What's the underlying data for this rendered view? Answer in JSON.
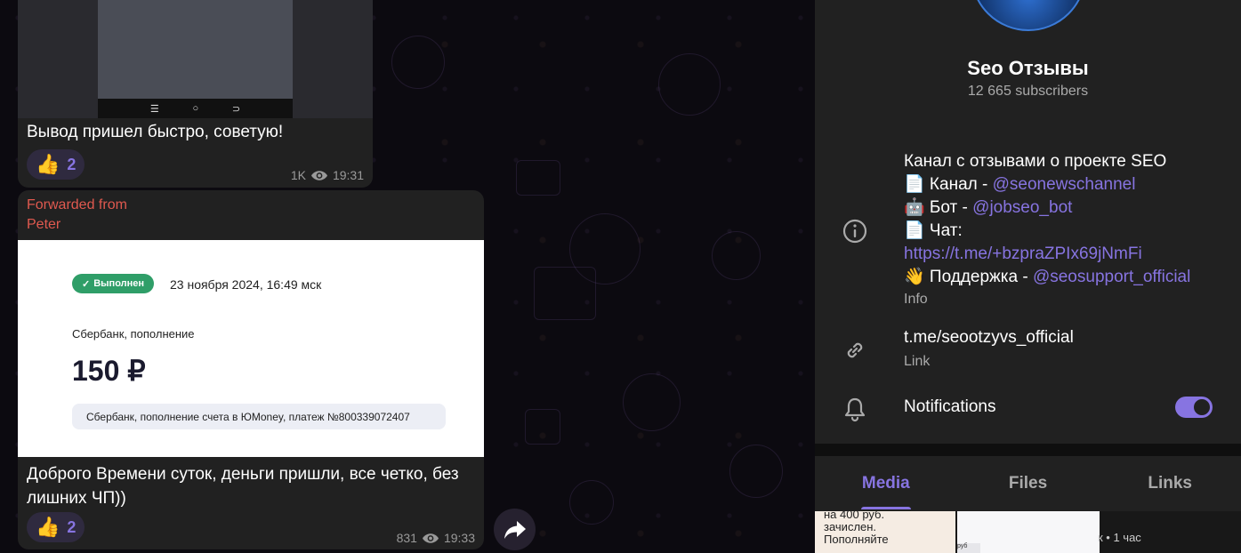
{
  "chat": {
    "msg1": {
      "nav_glyphs": [
        "☰",
        "○",
        "⊃"
      ],
      "caption": "Вывод пришел быстро, советую!",
      "reaction_emoji": "👍",
      "reaction_count": "2",
      "views": "1K",
      "time": "19:31"
    },
    "msg2": {
      "forwarded_label": "Forwarded from",
      "forwarded_name": "Peter",
      "receipt": {
        "status": "Выполнен",
        "date": "23 ноября 2024, 16:49 мск",
        "source": "Сбербанк, пополнение",
        "amount": "150 ₽",
        "details": "Сбербанк, пополнение счета в ЮMoney, платеж №800339072407"
      },
      "caption": "Доброго Времени суток, деньги пришли, все четко, без лишних ЧП))",
      "reaction_emoji": "👍",
      "reaction_count": "2",
      "views": "831",
      "time": "19:33"
    }
  },
  "panel": {
    "name": "Seo Отзывы",
    "subscribers": "12 665 subscribers",
    "description": {
      "line1": "Канал с отзывами о проекте SEO",
      "line2_label": "📄 Канал   - ",
      "line2_link": "@seonewschannel",
      "line3_label": "🤖 Бот      - ",
      "line3_link": "@jobseo_bot",
      "line4_label": "📄 Чат:",
      "line5_link": "https://t.me/+bzpraZPIx69jNmFi",
      "line6_label": "👋 Поддержка - ",
      "line6_link": "@seosupport_official"
    },
    "info_label": "Info",
    "link": "t.me/seootzyvs_official",
    "link_label": "Link",
    "notifications_label": "Notifications",
    "notifications_on": true,
    "tabs": [
      "Media",
      "Files",
      "Links"
    ],
    "active_tab": "Media",
    "media_preview": {
      "thumb1_lines": [
        "на 400 руб.",
        "зачислен.",
        "Пополняйте"
      ],
      "thumb2_text": "руб",
      "thumb3_text": "к • 1 час"
    }
  },
  "colors": {
    "accent": "#8774e1",
    "forward_name": "#e0594f",
    "bubble": "#212121",
    "status_badge": "#2f9e68"
  }
}
